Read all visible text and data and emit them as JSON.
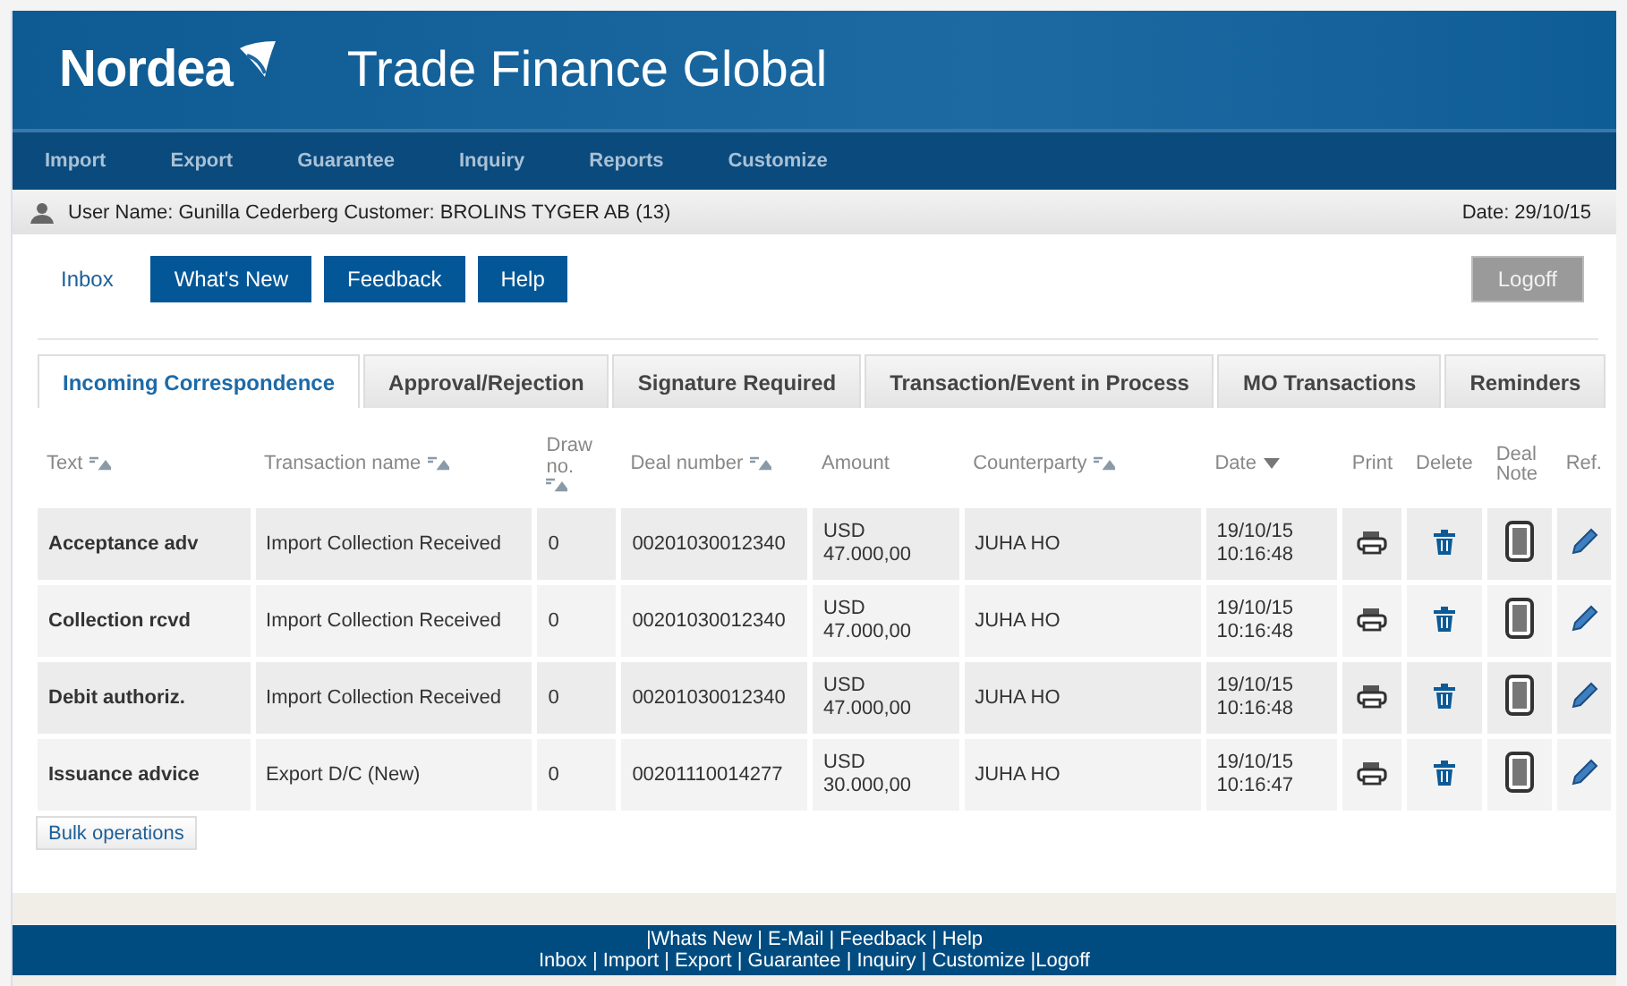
{
  "header": {
    "logo": "Nordea",
    "title": "Trade Finance Global"
  },
  "nav": [
    "Import",
    "Export",
    "Guarantee",
    "Inquiry",
    "Reports",
    "Customize"
  ],
  "userbar": {
    "user": "User Name: Gunilla Cederberg Customer: BROLINS TYGER AB (13)",
    "date": "Date: 29/10/15"
  },
  "toolbar": [
    {
      "label": "Inbox",
      "kind": "link"
    },
    {
      "label": "What's New",
      "kind": "button"
    },
    {
      "label": "Feedback",
      "kind": "button"
    },
    {
      "label": "Help",
      "kind": "button"
    }
  ],
  "logoff": "Logoff",
  "tabs": [
    {
      "label": "Incoming Correspondence",
      "selected": true
    },
    {
      "label": "Approval/Rejection",
      "selected": false
    },
    {
      "label": "Signature Required",
      "selected": false
    },
    {
      "label": "Transaction/Event in Process",
      "selected": false
    },
    {
      "label": "MO Transactions",
      "selected": false
    },
    {
      "label": "Reminders",
      "selected": false
    }
  ],
  "table": {
    "columns": [
      {
        "label": "Text",
        "kind": "sortable"
      },
      {
        "label": "Transaction name",
        "kind": "sortable"
      },
      {
        "label": "Draw no.",
        "kind": "sortable"
      },
      {
        "label": "Deal number",
        "kind": "sortable"
      },
      {
        "label": "Amount",
        "kind": "plain"
      },
      {
        "label": "Counterparty",
        "kind": "sortable"
      },
      {
        "label": "Date",
        "kind": "sorted"
      },
      {
        "label": "Print",
        "kind": "plain"
      },
      {
        "label": "Delete",
        "kind": "plain"
      },
      {
        "label": "Deal Note",
        "kind": "plain"
      },
      {
        "label": "Ref.",
        "kind": "plain"
      }
    ],
    "rows": [
      {
        "text": "Acceptance adv",
        "transaction": "Import Collection Received",
        "draw": "0",
        "deal": "00201030012340",
        "currency": "USD",
        "amount": "47.000,00",
        "counterparty": "JUHA HO",
        "date": "19/10/15",
        "time": "10:16:48"
      },
      {
        "text": "Collection rcvd",
        "transaction": "Import Collection Received",
        "draw": "0",
        "deal": "00201030012340",
        "currency": "USD",
        "amount": "47.000,00",
        "counterparty": "JUHA HO",
        "date": "19/10/15",
        "time": "10:16:48"
      },
      {
        "text": "Debit authoriz.",
        "transaction": "Import Collection Received",
        "draw": "0",
        "deal": "00201030012340",
        "currency": "USD",
        "amount": "47.000,00",
        "counterparty": "JUHA HO",
        "date": "19/10/15",
        "time": "10:16:48"
      },
      {
        "text": "Issuance advice",
        "transaction": "Export D/C (New)",
        "draw": "0",
        "deal": "00201110014277",
        "currency": "USD",
        "amount": "30.000,00",
        "counterparty": "JUHA HO",
        "date": "19/10/15",
        "time": "10:16:47"
      }
    ]
  },
  "bulk_button": "Bulk operations",
  "footer": [
    "|Whats New | E-Mail | Feedback | Help",
    "Inbox | Import | Export | Guarantee | Inquiry | Customize |Logoff"
  ]
}
